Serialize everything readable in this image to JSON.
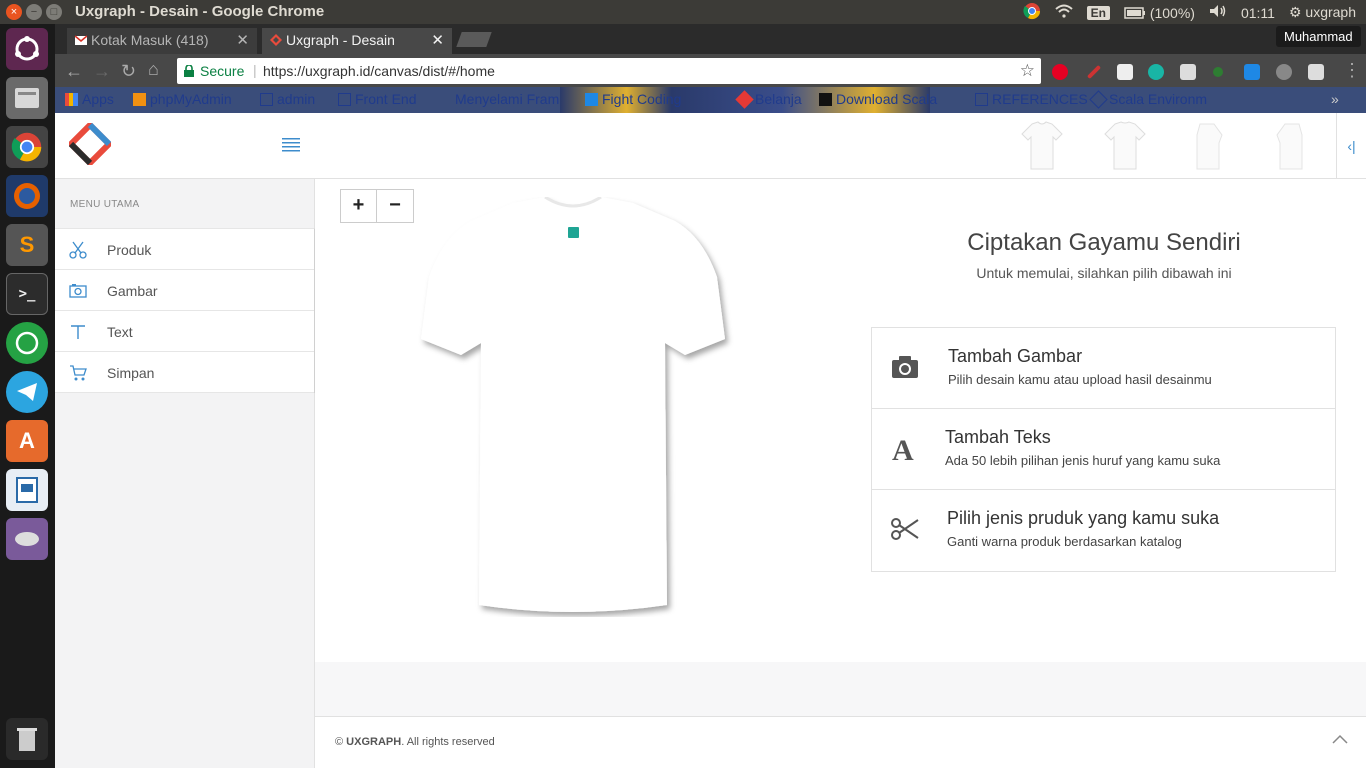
{
  "os_panel": {
    "window_title": "Uxgraph - Desain - Google Chrome",
    "keyboard": "En",
    "battery": "(100%)",
    "time": "01:11",
    "user": "uxgraph"
  },
  "browser": {
    "tabs": [
      {
        "label": "Kotak Masuk (418)",
        "active": false
      },
      {
        "label": "Uxgraph - Desain",
        "active": true
      }
    ],
    "profile_name": "Muhammad",
    "security_label": "Secure",
    "url": "https://uxgraph.id/canvas/dist/#/home",
    "bookmarks": [
      "Apps",
      "phpMyAdmin",
      "admin",
      "Front End",
      "Menyelami Fram",
      "Fight Coding",
      "Belanja",
      "Download Scala",
      "REFERENCES",
      "Scala Environm"
    ]
  },
  "sidebar": {
    "menu_title": "MENU UTAMA",
    "items": [
      {
        "label": "Produk",
        "icon": "scissors-icon"
      },
      {
        "label": "Gambar",
        "icon": "camera-icon"
      },
      {
        "label": "Text",
        "icon": "text-icon"
      },
      {
        "label": "Simpan",
        "icon": "cart-icon"
      }
    ]
  },
  "canvas": {
    "zoom_in": "+",
    "zoom_out": "−"
  },
  "hero": {
    "title": "Ciptakan Gayamu Sendiri",
    "subtitle": "Untuk memulai, silahkan pilih dibawah ini"
  },
  "options": [
    {
      "title": "Tambah Gambar",
      "desc": "Pilih desain kamu atau upload hasil desainmu",
      "icon": "camera-icon"
    },
    {
      "title": "Tambah Teks",
      "desc": "Ada 50 lebih pilihan jenis huruf yang kamu suka",
      "icon": "font-icon"
    },
    {
      "title": "Pilih jenis pruduk yang kamu suka",
      "desc": "Ganti warna produk berdasarkan katalog",
      "icon": "scissors-icon"
    }
  ],
  "footer": {
    "brand": "UXGRAPH",
    "copyright_prefix": "© ",
    "copyright_suffix": ". All rights reserved"
  },
  "colors": {
    "accent": "#3d8ccc",
    "secure_green": "#0b8043",
    "ubuntu_orange": "#e95420"
  }
}
